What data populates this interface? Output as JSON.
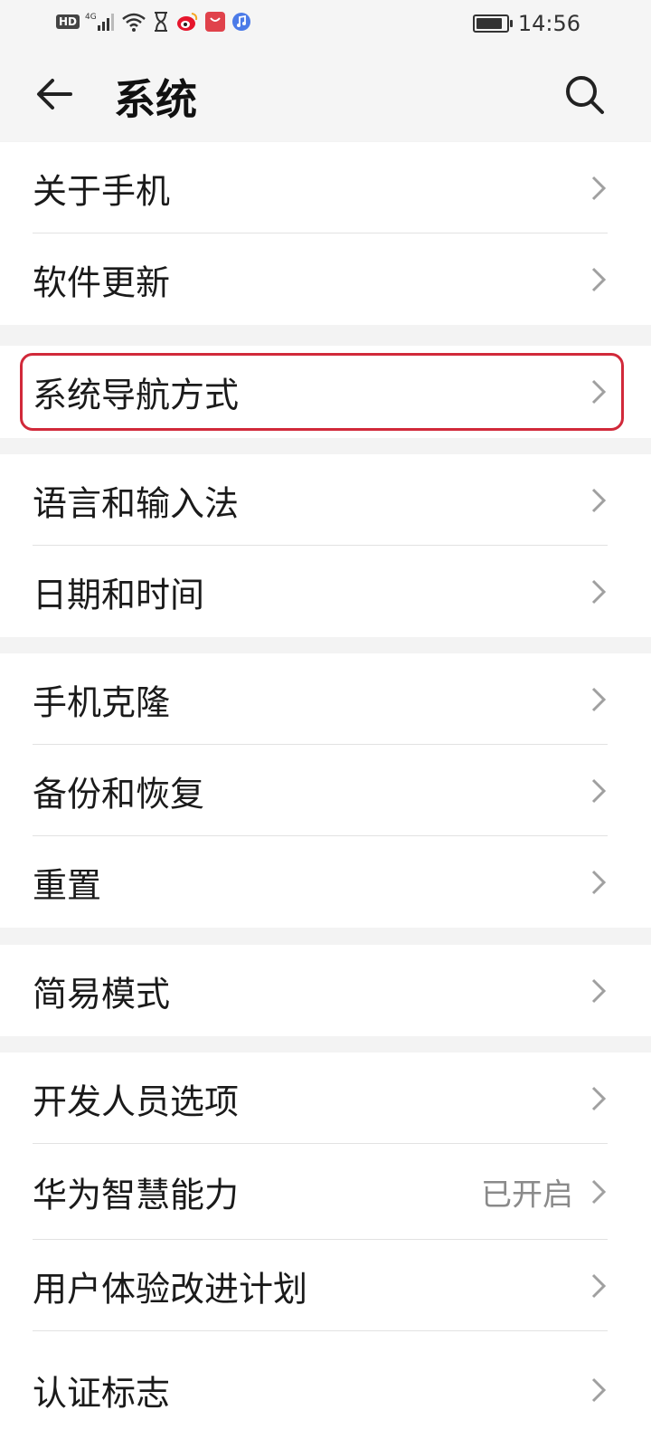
{
  "status_bar": {
    "left_icons": [
      "hd-icon",
      "4g-signal-icon",
      "wifi-icon",
      "hourglass-icon",
      "weibo-icon",
      "shop-icon",
      "music-icon"
    ],
    "hd_label": "HD",
    "time": "14:56",
    "battery_level": 0.9
  },
  "header": {
    "title": "系统"
  },
  "colors": {
    "highlight_border": "#d1293a",
    "background": "#f3f3f3",
    "row_background": "#ffffff",
    "secondary_text": "#8a8a8a"
  },
  "groups": [
    {
      "items": [
        {
          "label": "关于手机"
        },
        {
          "label": "软件更新"
        }
      ]
    },
    {
      "items": [
        {
          "label": "系统导航方式",
          "highlighted": true
        }
      ]
    },
    {
      "items": [
        {
          "label": "语言和输入法"
        },
        {
          "label": "日期和时间"
        }
      ]
    },
    {
      "items": [
        {
          "label": "手机克隆"
        },
        {
          "label": "备份和恢复"
        },
        {
          "label": "重置"
        }
      ]
    },
    {
      "items": [
        {
          "label": "简易模式"
        }
      ]
    },
    {
      "items": [
        {
          "label": "开发人员选项"
        },
        {
          "label": "华为智慧能力",
          "value": "已开启"
        },
        {
          "label": "用户体验改进计划"
        },
        {
          "label": "认证标志"
        }
      ]
    }
  ]
}
